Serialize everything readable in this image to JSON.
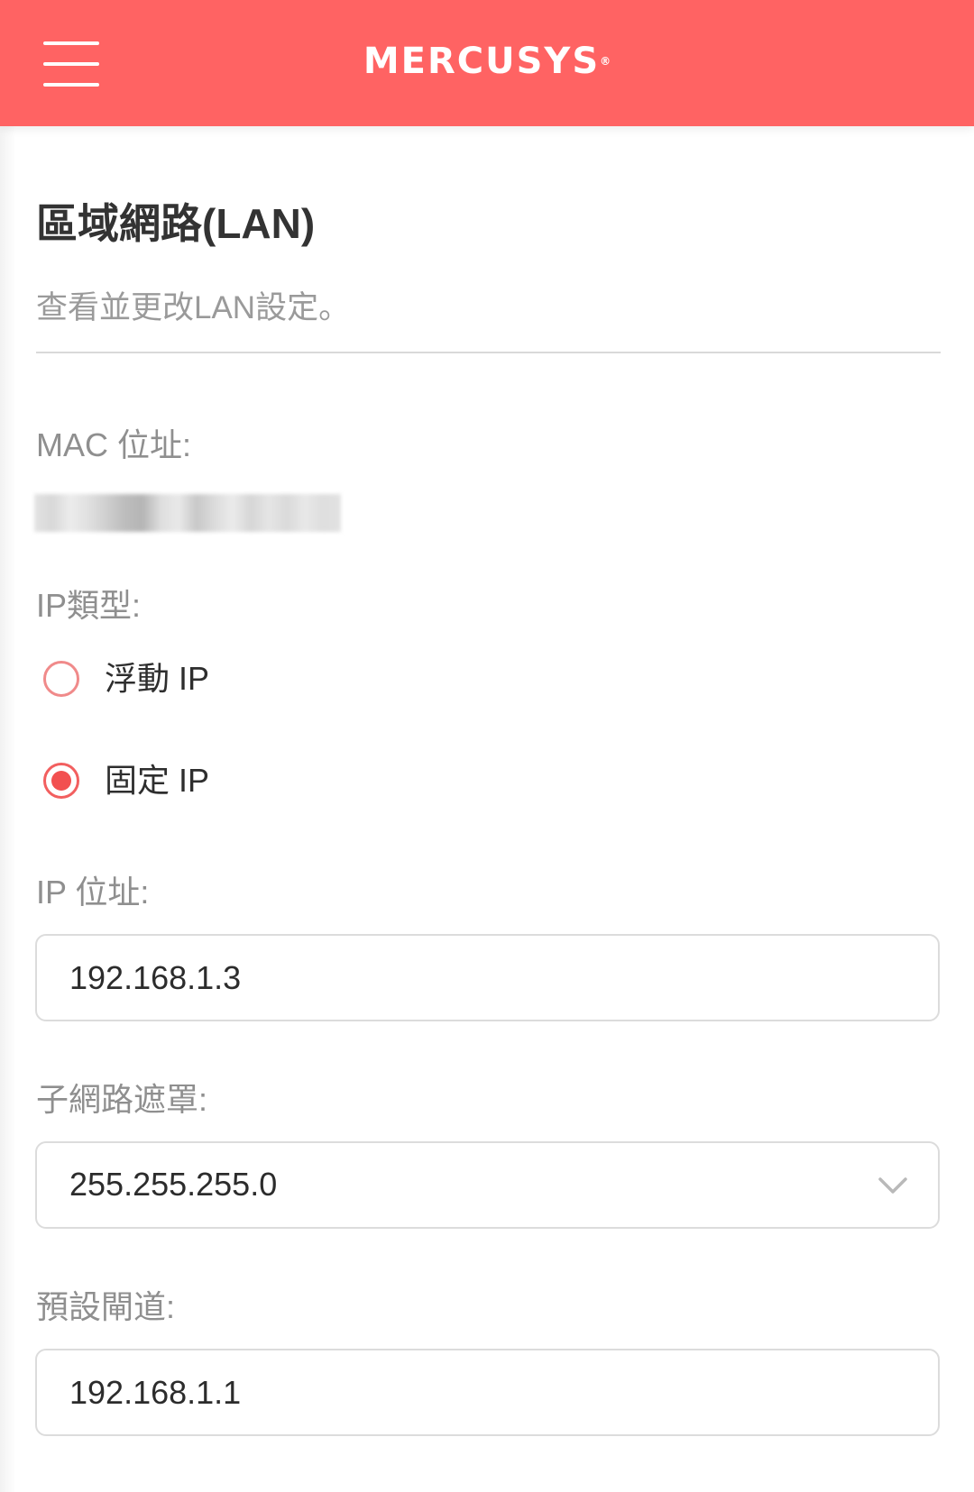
{
  "header": {
    "menu_icon": "hamburger-menu-icon",
    "brand": "MERCUSYS",
    "brand_mark": "®",
    "background_color": "#ff6363"
  },
  "page": {
    "title": "區域網路(LAN)",
    "subtitle": "查看並更改LAN設定。"
  },
  "mac": {
    "label": "MAC 位址:"
  },
  "ip_type": {
    "label": "IP類型:",
    "options": [
      {
        "label": "浮動 IP",
        "checked": false
      },
      {
        "label": "固定 IP",
        "checked": true
      }
    ]
  },
  "ip_address": {
    "label": "IP 位址:",
    "value": "192.168.1.3"
  },
  "subnet_mask": {
    "label": "子網路遮罩:",
    "value": "255.255.255.0",
    "icon": "chevron-down-icon"
  },
  "gateway": {
    "label": "預設閘道:",
    "value": "192.168.1.1"
  },
  "colors": {
    "accent": "#ff6363",
    "radio_selected": "#f25050"
  }
}
